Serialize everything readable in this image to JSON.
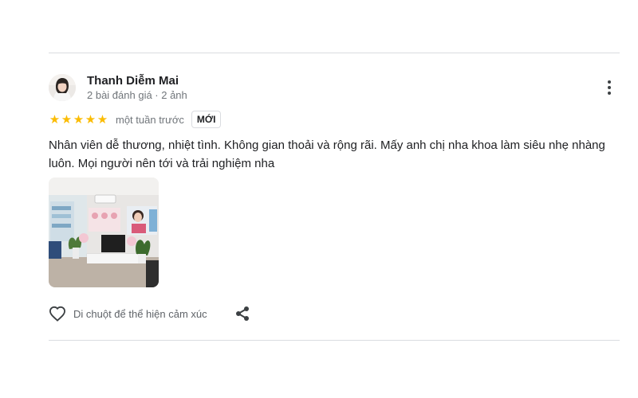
{
  "review": {
    "reviewer_name": "Thanh Diễm Mai",
    "reviewer_meta": "2 bài đánh giá · 2 ảnh",
    "rating": 5,
    "stars": [
      "★",
      "★",
      "★",
      "★",
      "★"
    ],
    "time": "một tuần trước",
    "badge": "MỚI",
    "text": "Nhân viên dễ thương, nhiệt tình. Không gian thoải và rộng rãi. Mấy anh chị nha khoa làm siêu nhẹ nhàng luôn. Mọi người nên tới và trải nghiệm nha",
    "more_icon": "more-vert-icon",
    "like_icon": "heart-outline-icon",
    "share_icon": "share-icon"
  },
  "actions": {
    "like_label": "Di chuột để thể hiện cảm xúc"
  },
  "colors": {
    "star": "#fbbc04",
    "divider": "#dadce0",
    "secondary_text": "#70757a"
  }
}
